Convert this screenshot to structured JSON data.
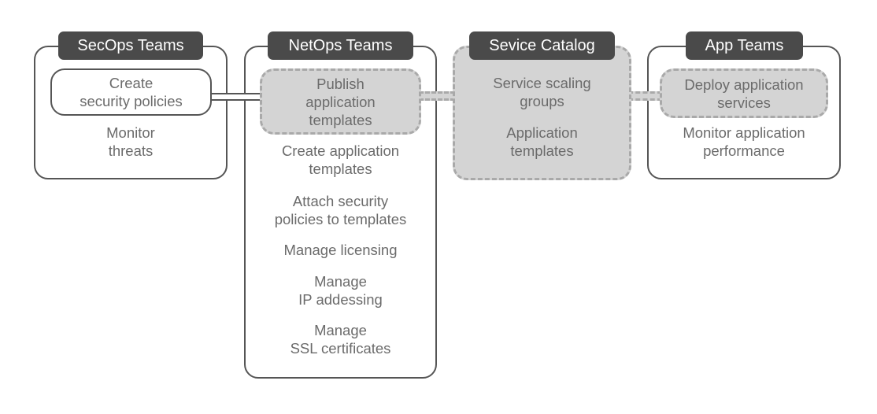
{
  "diagram": {
    "groups": [
      {
        "title": "SecOps Teams",
        "highlight": {
          "label": "Create\nsecurity policies",
          "style": "solid"
        },
        "items": [
          "Monitor\nthreats"
        ]
      },
      {
        "title": "NetOps Teams",
        "highlight": {
          "label": "Publish\napplication\ntemplates",
          "style": "dashed"
        },
        "items": [
          "Create application\ntemplates",
          "Attach security\npolicies to templates",
          "Manage licensing",
          "Manage\nIP addessing",
          "Manage\nSSL certificates"
        ]
      },
      {
        "title": "Sevice Catalog",
        "items": [
          "Service scaling\ngroups",
          "Application\ntemplates"
        ]
      },
      {
        "title": "App Teams",
        "highlight": {
          "label": "Deploy application\nservices",
          "style": "dashed"
        },
        "items": [
          "Monitor application\nperformance"
        ]
      }
    ],
    "connectors": [
      {
        "from": "Create security policies",
        "to": "NetOps Teams",
        "style": "solid"
      },
      {
        "from": "Publish application templates",
        "to": "Sevice Catalog",
        "style": "dashed"
      },
      {
        "from": "Sevice Catalog",
        "to": "Deploy application services",
        "style": "dashed"
      }
    ],
    "colors": {
      "tab_bg": "#4a4a4a",
      "tab_text": "#ffffff",
      "border": "#555555",
      "dashed_border": "#a9a9a9",
      "dashed_fill": "#d4d4d4",
      "text": "#6b6b6b"
    }
  }
}
